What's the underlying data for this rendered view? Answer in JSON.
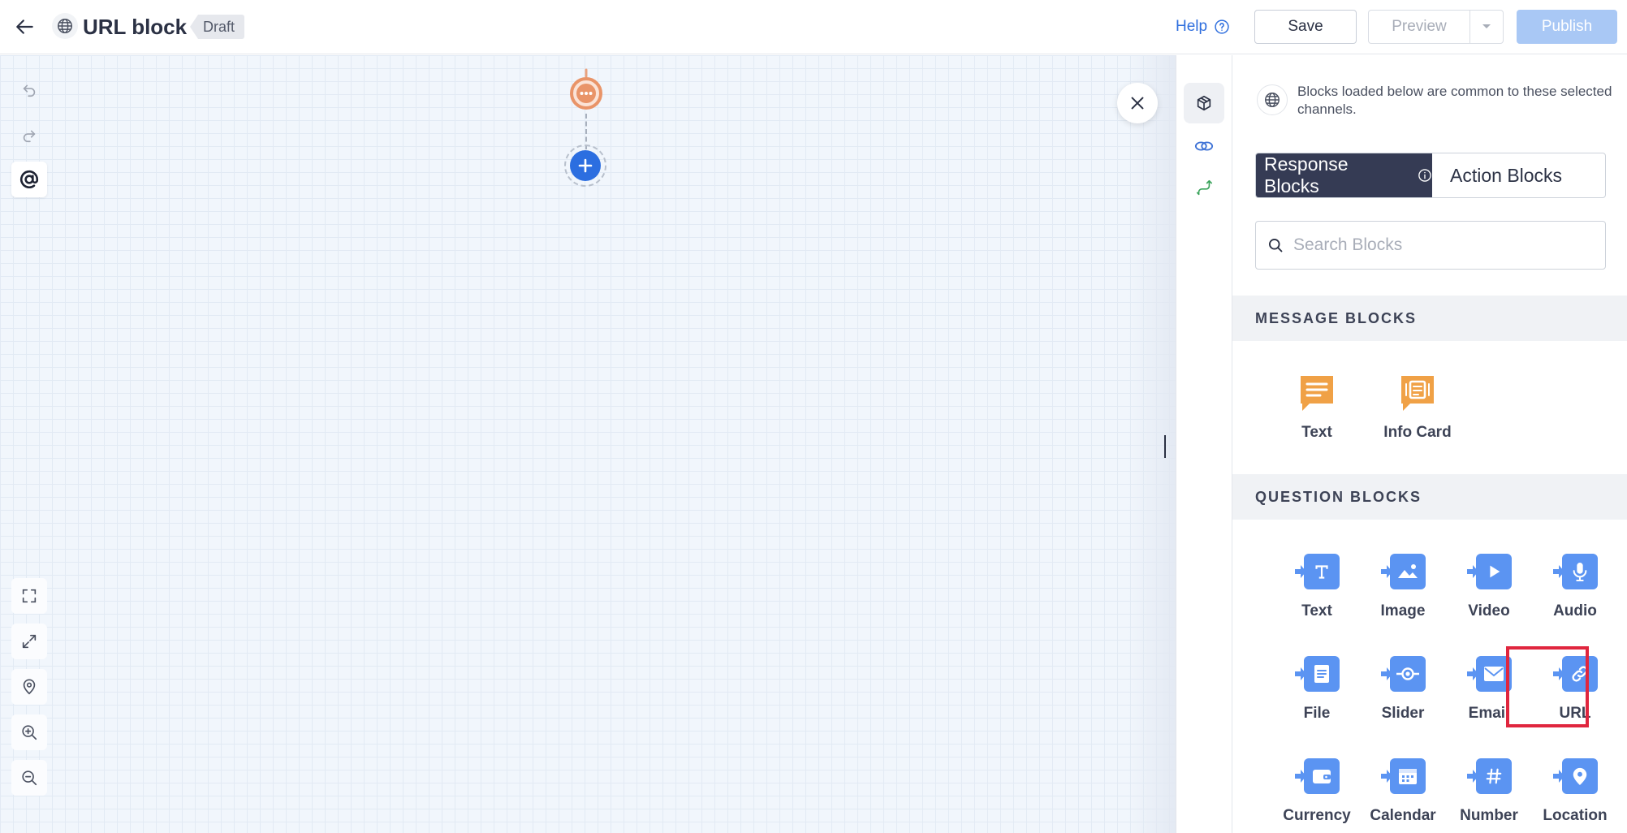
{
  "header": {
    "title": "URL block",
    "status_badge": "Draft",
    "help_label": "Help",
    "save_label": "Save",
    "preview_label": "Preview",
    "publish_label": "Publish"
  },
  "canvas_tools": {
    "top": [
      "undo-icon",
      "redo-icon",
      "mention-icon"
    ],
    "bottom": [
      "fit-screen-icon",
      "expand-icon",
      "location-pin-icon",
      "zoom-in-icon",
      "zoom-out-icon"
    ]
  },
  "right_rail": [
    "cube-icon",
    "linked-rings-icon",
    "route-icon"
  ],
  "panel": {
    "notice": "Blocks loaded below are common to these selected channels.",
    "tabs": {
      "response": "Response Blocks",
      "action": "Action Blocks"
    },
    "search_placeholder": "Search Blocks",
    "message_section": {
      "title": "MESSAGE BLOCKS",
      "items": [
        {
          "label": "Text",
          "icon": "text-message-icon"
        },
        {
          "label": "Info Card",
          "icon": "info-card-icon"
        }
      ]
    },
    "question_section": {
      "title": "QUESTION BLOCKS",
      "items": [
        {
          "label": "Text",
          "icon": "text-icon"
        },
        {
          "label": "Image",
          "icon": "image-icon"
        },
        {
          "label": "Video",
          "icon": "video-icon"
        },
        {
          "label": "Audio",
          "icon": "microphone-icon"
        },
        {
          "label": "File",
          "icon": "file-icon"
        },
        {
          "label": "Slider",
          "icon": "slider-icon"
        },
        {
          "label": "Email",
          "icon": "email-icon"
        },
        {
          "label": "URL",
          "icon": "link-icon"
        },
        {
          "label": "Currency",
          "icon": "wallet-icon"
        },
        {
          "label": "Calendar",
          "icon": "calendar-icon"
        },
        {
          "label": "Number",
          "icon": "hash-icon"
        },
        {
          "label": "Location",
          "icon": "location-icon"
        }
      ]
    }
  },
  "colors": {
    "accent_blue": "#2c6ee0",
    "block_blue": "#5b94f2",
    "message_orange": "#f0a146",
    "active_tab": "#353b54",
    "highlight_red": "#e0263e"
  }
}
